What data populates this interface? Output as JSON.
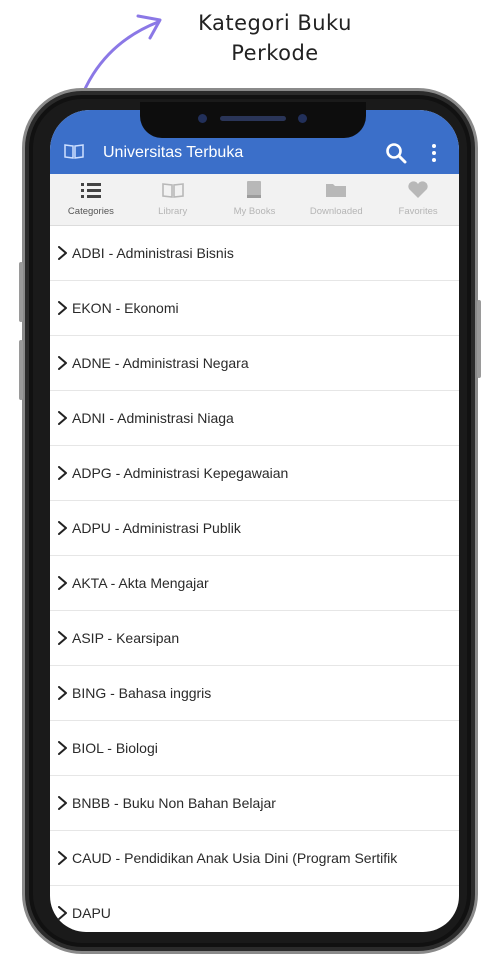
{
  "callout": {
    "line1": "Kategori Buku",
    "line2": "Perkode"
  },
  "appbar": {
    "title": "Universitas Terbuka",
    "color": "#3b6fc9",
    "icons": [
      "book-icon",
      "search-icon",
      "more-vert-icon"
    ]
  },
  "tabs": [
    {
      "label": "Categories",
      "icon": "list-icon",
      "active": true
    },
    {
      "label": "Library",
      "icon": "open-book-icon",
      "active": false
    },
    {
      "label": "My Books",
      "icon": "book-icon",
      "active": false
    },
    {
      "label": "Downloaded",
      "icon": "folder-icon",
      "active": false
    },
    {
      "label": "Favorites",
      "icon": "heart-icon",
      "active": false
    }
  ],
  "categories": [
    "ADBI - Administrasi Bisnis",
    "EKON - Ekonomi",
    "ADNE - Administrasi Negara",
    "ADNI - Administrasi Niaga",
    "ADPG - Administrasi Kepegawaian",
    "ADPU - Administrasi Publik",
    "AKTA - Akta Mengajar",
    "ASIP - Kearsipan",
    "BING - Bahasa inggris",
    "BIOL - Biologi",
    "BNBB - Buku Non Bahan Belajar",
    "CAUD - Pendidikan Anak Usia Dini (Program Sertifik",
    "DAPU"
  ]
}
